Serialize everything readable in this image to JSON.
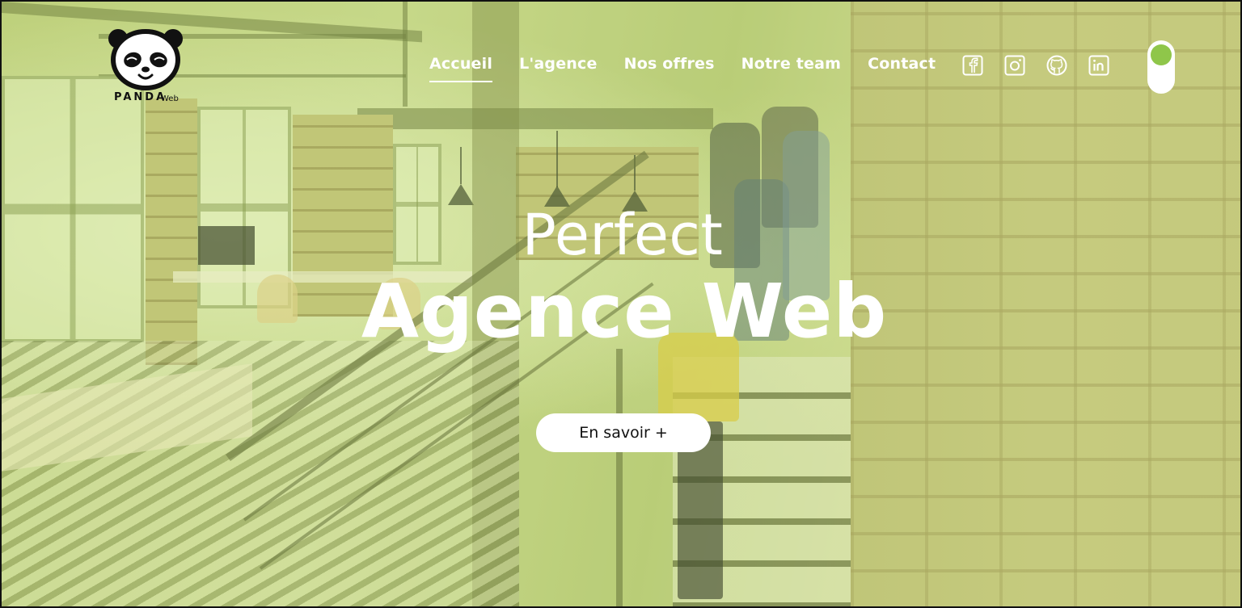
{
  "brand": {
    "name": "PANDA",
    "suffix": "Web",
    "logo_icon": "panda-head-icon"
  },
  "nav": {
    "items": [
      {
        "label": "Accueil",
        "active": true
      },
      {
        "label": "L'agence",
        "active": false
      },
      {
        "label": "Nos offres",
        "active": false
      },
      {
        "label": "Notre team",
        "active": false
      },
      {
        "label": "Contact",
        "active": false
      }
    ]
  },
  "socials": [
    {
      "icon": "facebook-icon"
    },
    {
      "icon": "instagram-icon"
    },
    {
      "icon": "github-icon"
    },
    {
      "icon": "linkedin-icon"
    }
  ],
  "theme_toggle": {
    "icon": "theme-toggle-switch",
    "knob_color": "#8fc64a"
  },
  "hero": {
    "pretitle": "Perfect",
    "title": "Agence Web",
    "cta_label": "En savoir +"
  },
  "colors": {
    "overlay_tint": "#c8de78",
    "text": "#ffffff",
    "accent_green": "#8fc64a"
  }
}
